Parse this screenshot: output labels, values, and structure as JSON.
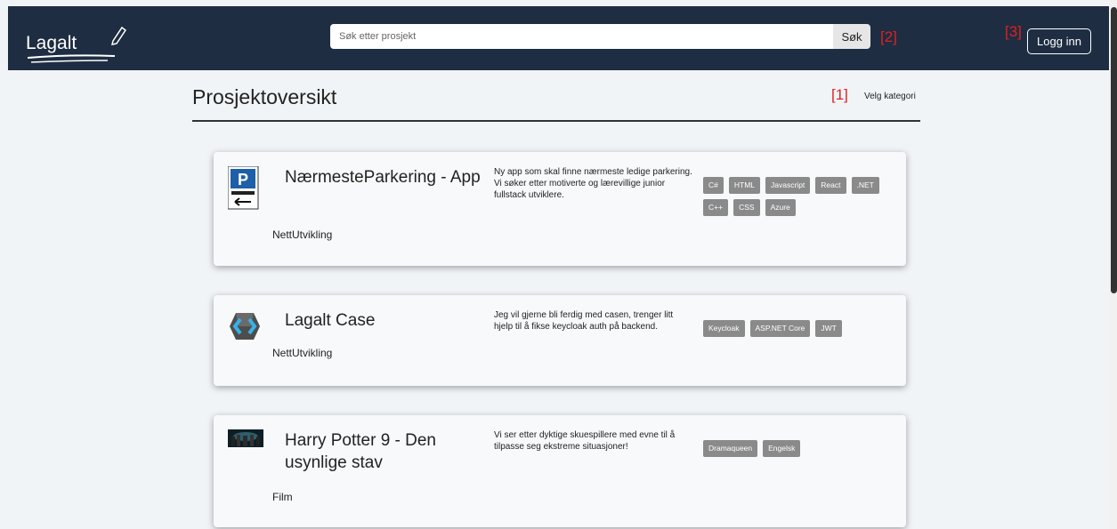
{
  "header": {
    "logo_text": "Lagalt",
    "search_placeholder": "Søk etter prosjekt",
    "search_button": "Søk",
    "marker_search": "[2]",
    "marker_login": "[3]",
    "login_button": "Logg inn"
  },
  "main": {
    "title": "Prosjektoversikt",
    "marker_category": "[1]",
    "category_label": "Velg kategori"
  },
  "projects": [
    {
      "title": "NærmesteParkering - App",
      "category": "NettUtvikling",
      "description": "Ny app som skal finne nærmeste ledige parkering. Vi søker etter motiverte og lærevillige junior fullstack utviklere.",
      "icon": "parking-sign-icon",
      "tags": [
        "C#",
        "HTML",
        "Javascript",
        "React",
        ".NET",
        "C++",
        "CSS",
        "Azure"
      ]
    },
    {
      "title": "Lagalt Case",
      "category": "NettUtvikling",
      "description": "Jeg vil gjerne bli ferdig med casen, trenger litt hjelp til å fikse keycloak auth på backend.",
      "icon": "keycloak-logo-icon",
      "tags": [
        "Keycloak",
        "ASP.NET Core",
        "JWT"
      ]
    },
    {
      "title": "Harry Potter 9 - Den usynlige stav",
      "category": "Film",
      "description": "Vi ser etter dyktige skuespillere med evne til å tilpasse seg ekstreme situasjoner!",
      "icon": "movie-thumbnail-icon",
      "tags": [
        "Dramaqueen",
        "Engelsk"
      ]
    }
  ],
  "colors": {
    "header_bg": "#1e2d42",
    "page_bg": "#f1f4f7",
    "tag_bg": "#8a8a8a",
    "marker": "#e02020"
  }
}
